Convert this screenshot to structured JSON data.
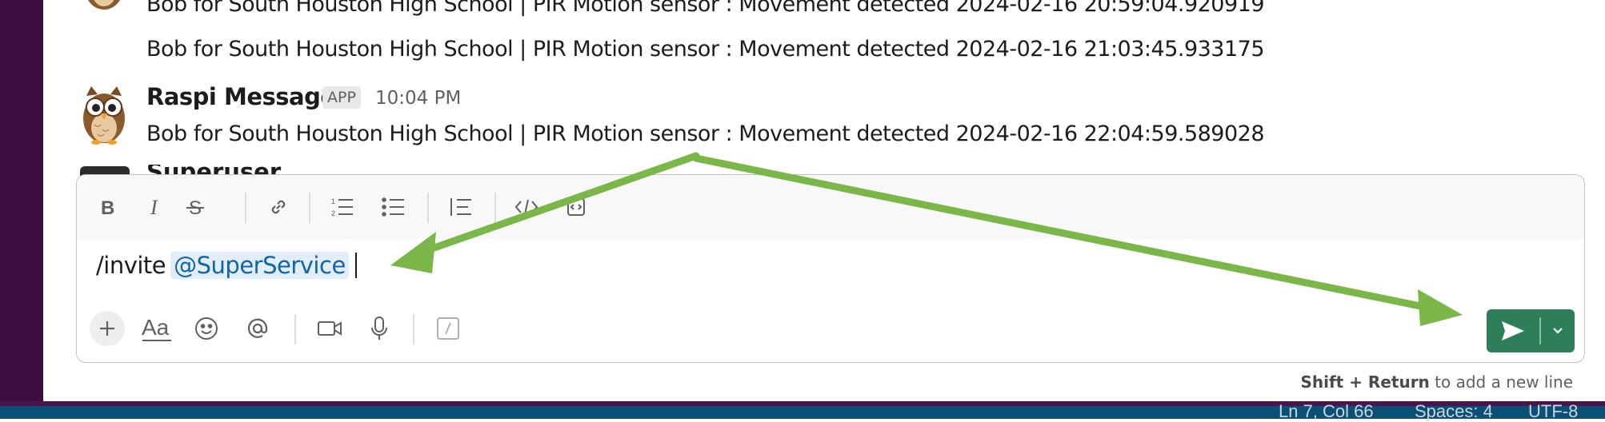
{
  "messages": [
    {
      "text": "Bob for South Houston High School | PIR Motion sensor : Movement detected 2024-02-16 20:59:04.920919"
    },
    {
      "text": "Bob for South Houston High School | PIR Motion sensor : Movement detected 2024-02-16 21:03:45.933175"
    },
    {
      "sender": "Raspi Messages",
      "badge": "APP",
      "time": "10:04 PM",
      "text": "Bob for South Houston High School | PIR Motion sensor : Movement detected 2024-02-16 22:04:59.589028"
    }
  ],
  "partial_sender": "Superuser Servi",
  "composer": {
    "command": "/invite",
    "mention": "@SuperService",
    "toolbar_icons": [
      "bold-icon",
      "italic-icon",
      "strikethrough-icon",
      "link-icon",
      "ordered-list-icon",
      "bulleted-list-icon",
      "blockquote-icon",
      "code-icon",
      "code-block-icon"
    ],
    "bottom_icons": [
      "plus-icon",
      "format-text-icon",
      "emoji-icon",
      "mention-icon",
      "video-icon",
      "microphone-icon",
      "shortcut-icon"
    ],
    "hint_key": "Shift + Return",
    "hint_text": "to add a new line"
  },
  "statusbar": {
    "position": "Ln 7, Col 66",
    "spaces": "Spaces: 4",
    "encoding": "UTF-8"
  },
  "colors": {
    "sidebar": "#3f0e40",
    "send_button": "#2e7d5b",
    "annotation_arrow": "#7ab648",
    "mention_bg": "#e1eefa",
    "mention_fg": "#1264a3",
    "statusbar": "#0a4f75"
  }
}
